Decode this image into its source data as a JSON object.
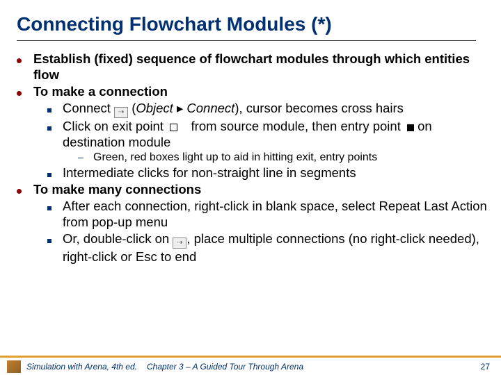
{
  "title": "Connecting Flowchart Modules (*)",
  "bullets": {
    "b1": "Establish (fixed) sequence of flowchart modules through which entities flow",
    "b2": "To make a connection",
    "b2_1a": "Connect ",
    "b2_1b": "(",
    "b2_1c": "Object",
    "b2_1d": " Connect",
    "b2_1e": "), cursor becomes cross hairs",
    "b2_2a": "Click on exit point",
    "b2_2b": "from source module, then entry point",
    "b2_2c": "on destination module",
    "b2_2_1": "Green, red boxes light up to aid in hitting exit, entry points",
    "b2_3": "Intermediate clicks for non-straight line in segments",
    "b3": "To make many connections",
    "b3_1": "After each connection, right-click in blank space, select Repeat Last Action from pop-up menu",
    "b3_2a": "Or, double-click on ",
    "b3_2b": ", place multiple connections (no right-click needed), right-click or Esc to end"
  },
  "footer": {
    "left": "Simulation with Arena, 4th ed.",
    "mid": "Chapter 3 – A Guided Tour Through Arena",
    "page": "27"
  },
  "glyphs": {
    "tri": "▸",
    "conn": "⇢"
  }
}
